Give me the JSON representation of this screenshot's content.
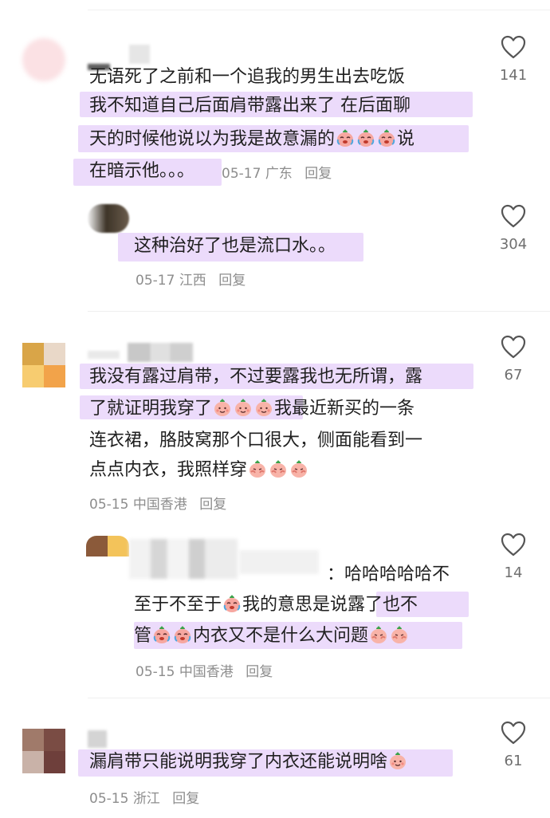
{
  "colors": {
    "highlight": "#ead7fb",
    "text": "#1f1f1f",
    "meta": "#8d8d8d",
    "count": "#6f6f6f"
  },
  "icons": {
    "like": "heart-outline-icon",
    "emoji_laugh_cry": "laugh-cry-emoji-icon",
    "emoji_smile": "peach-smile-emoji-icon",
    "emoji_shy": "peach-shy-emoji-icon"
  },
  "comments": [
    {
      "lines": [
        "无语死了之前和一个追我的男生出去吃饭",
        "我不知道自己后面肩带露出来了  在后面聊",
        "天的时候他说以为我是故意漏的",
        "说",
        "在暗示他。。。"
      ],
      "date": "05-17",
      "location": "广东",
      "reply_label": "回复",
      "likes": "141"
    },
    {
      "lines": [
        "这种治好了也是流口水。。"
      ],
      "date": "05-17",
      "location": "江西",
      "reply_label": "回复",
      "likes": "304"
    },
    {
      "lines": [
        "我没有露过肩带，不过要露我也无所谓，露",
        "了就证明我穿了",
        "我最近新买的一条",
        "连衣裙，胳肢窝那个口很大，侧面能看到一",
        "点点内衣，我照样穿"
      ],
      "date": "05-15",
      "location": "中国香港",
      "reply_label": "回复",
      "likes": "67"
    },
    {
      "lines": [
        "：哈哈哈哈哈不",
        "至于不至于",
        "我的意思是说露了也不",
        "管",
        "内衣又不是什么大问题"
      ],
      "date": "05-15",
      "location": "中国香港",
      "reply_label": "回复",
      "likes": "14"
    },
    {
      "lines": [
        "漏肩带只能说明我穿了内衣还能说明啥"
      ],
      "date": "05-15",
      "location": "浙江",
      "reply_label": "回复",
      "likes": "61"
    }
  ]
}
